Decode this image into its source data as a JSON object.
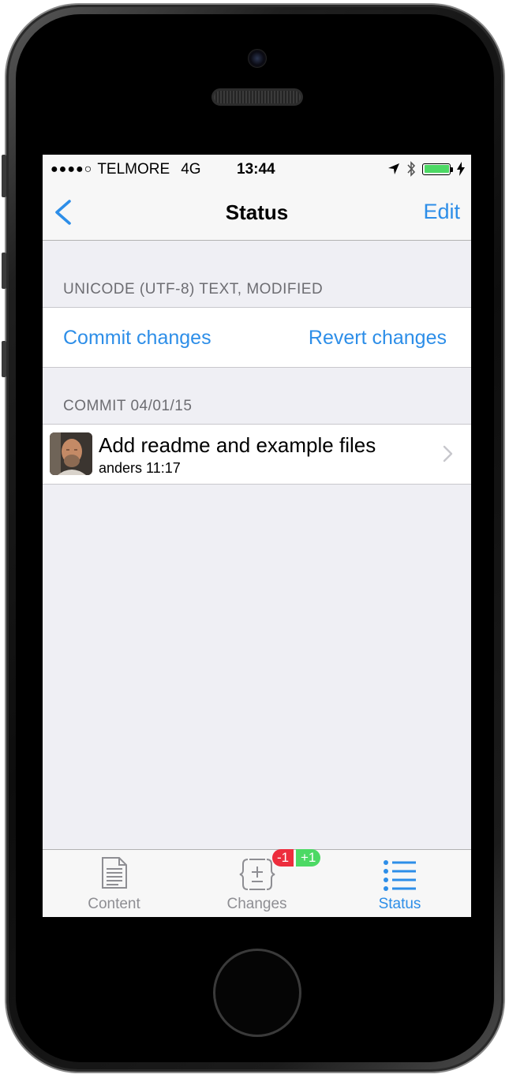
{
  "statusbar": {
    "signal": "●●●●○",
    "carrier": "TELMORE",
    "network": "4G",
    "time": "13:44"
  },
  "navbar": {
    "back_icon": "chevron-left-icon",
    "title": "Status",
    "edit_label": "Edit"
  },
  "file_section": {
    "header": "UNICODE (UTF-8) TEXT, MODIFIED",
    "commit_label": "Commit changes",
    "revert_label": "Revert changes"
  },
  "commit_section": {
    "header": "COMMIT 04/01/15",
    "title": "Add readme and example files",
    "author_time": "anders 11:17"
  },
  "tabbar": {
    "tabs": [
      {
        "label": "Content",
        "icon": "document-icon",
        "active": false
      },
      {
        "label": "Changes",
        "icon": "diff-icon",
        "active": false
      },
      {
        "label": "Status",
        "icon": "list-icon",
        "active": true
      }
    ],
    "badge_minus": "-1",
    "badge_plus": "+1"
  },
  "colors": {
    "accent": "#2d8ee8",
    "badge_red": "#ed2d3d",
    "badge_green": "#4cd964",
    "battery": "#4cd964"
  }
}
